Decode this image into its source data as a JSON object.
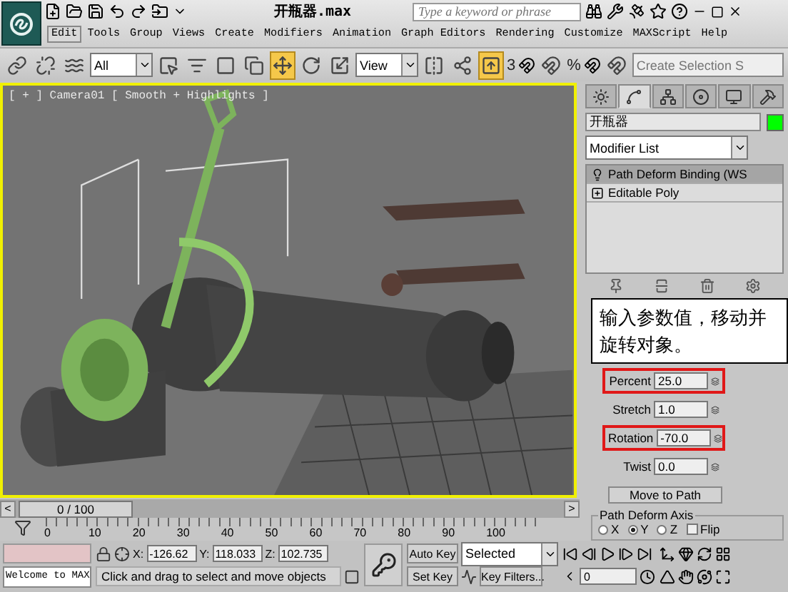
{
  "title_bar": {
    "title": "开瓶器.max",
    "search": {
      "placeholder": "Type a keyword or phrase"
    }
  },
  "menu": [
    {
      "label": "Edit",
      "selected": true
    },
    {
      "label": "Tools",
      "selected": false
    },
    {
      "label": "Group",
      "selected": false
    },
    {
      "label": "Views",
      "selected": false
    },
    {
      "label": "Create",
      "selected": false
    },
    {
      "label": "Modifiers",
      "selected": false
    },
    {
      "label": "Animation",
      "selected": false
    },
    {
      "label": "Graph Editors",
      "selected": false
    },
    {
      "label": "Rendering",
      "selected": false
    },
    {
      "label": "Customize",
      "selected": false
    },
    {
      "label": "MAXScript",
      "selected": false
    },
    {
      "label": "Help",
      "selected": false
    }
  ],
  "toolbar": {
    "selection_filter": "All",
    "reference_coord": "View",
    "snap_labels": [
      "3",
      "%"
    ],
    "named_selection": {
      "placeholder": "Create Selection S"
    }
  },
  "viewport": {
    "label": "[ + ] Camera01 [ Smooth + Highlights ]",
    "active": true
  },
  "command_panel": {
    "tabs": [
      {
        "kind": "create",
        "selected": false
      },
      {
        "kind": "modify",
        "selected": true
      },
      {
        "kind": "hierarchy",
        "selected": false
      },
      {
        "kind": "motion",
        "selected": false
      },
      {
        "kind": "display",
        "selected": false
      },
      {
        "kind": "utilities",
        "selected": false
      }
    ],
    "object_name": "开瓶器",
    "color": "#00ff00",
    "modifier_list": "Modifier List",
    "stack": [
      {
        "label": "Path Deform Binding (WS",
        "kind": "modifier",
        "selected": true
      },
      {
        "label": "Editable Poly",
        "kind": "base",
        "selected": false
      }
    ],
    "callout": "输入参数值，移动并旋转对象。",
    "parameters": [
      {
        "label": "Percent",
        "value": "25.0",
        "highlighted": true
      },
      {
        "label": "Stretch",
        "value": "1.0",
        "highlighted": false
      },
      {
        "label": "Rotation",
        "value": "-70.0",
        "highlighted": true
      },
      {
        "label": "Twist",
        "value": "0.0",
        "highlighted": false
      }
    ],
    "move_to_path": "Move to Path",
    "axis_group": {
      "title": "Path Deform Axis",
      "options": [
        {
          "label": "X",
          "selected": false
        },
        {
          "label": "Y",
          "selected": true
        },
        {
          "label": "Z",
          "selected": false
        }
      ],
      "flip": {
        "label": "Flip",
        "checked": false
      }
    }
  },
  "time_slider": {
    "label": "0 / 100",
    "prev": "<",
    "next": ">"
  },
  "track_ticks": [
    "0",
    "10",
    "20",
    "30",
    "40",
    "50",
    "60",
    "70",
    "80",
    "90",
    "100"
  ],
  "status": {
    "listener_output": "Welcome to MAX",
    "coords": [
      {
        "axis": "X:",
        "value": "-126.62"
      },
      {
        "axis": "Y:",
        "value": "118.033"
      },
      {
        "axis": "Z:",
        "value": "102.735"
      }
    ],
    "prompt": "Click and drag to select and move objects"
  },
  "animation": {
    "auto_key": "Auto Key",
    "set_key": "Set Key",
    "key_mode": "Selected",
    "key_filters": "Key Filters...",
    "frame": "0"
  }
}
